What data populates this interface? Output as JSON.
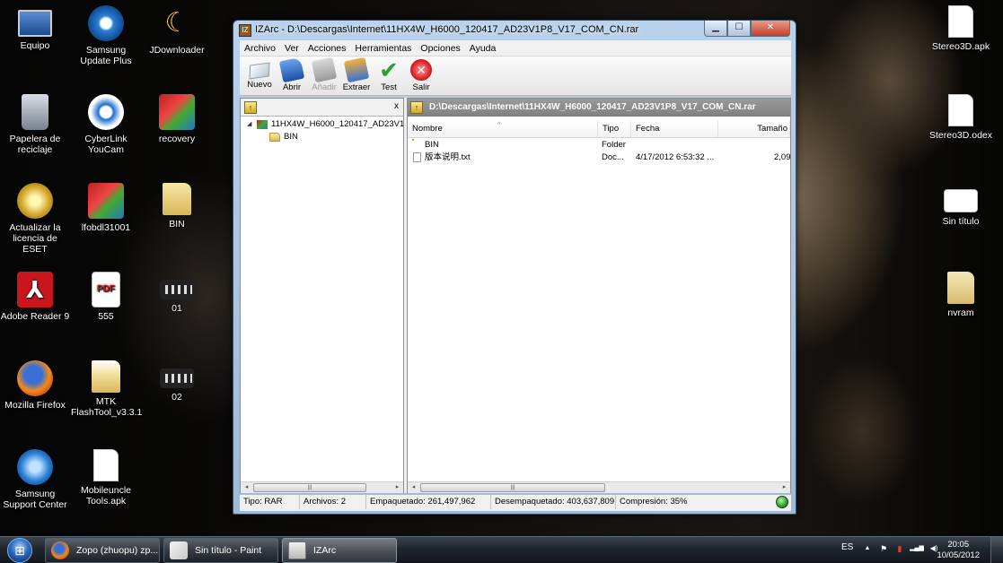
{
  "desktop": {
    "left_icons": [
      {
        "label": "Equipo",
        "icon": "computer-icon"
      },
      {
        "label": "Samsung Update Plus",
        "icon": "samsung-update-icon"
      },
      {
        "label": "JDownloader",
        "icon": "jdownloader-icon"
      },
      {
        "label": "Papelera de reciclaje",
        "icon": "recycle-bin-icon"
      },
      {
        "label": "CyberLink YouCam",
        "icon": "cyberlink-youcam-icon"
      },
      {
        "label": "recovery",
        "icon": "winrar-archive-icon"
      },
      {
        "label": "Actualizar la licencia de ESET",
        "icon": "eset-icon"
      },
      {
        "label": "lfobdl31001",
        "icon": "winrar-archive-icon"
      },
      {
        "label": "BIN",
        "icon": "folder-icon"
      },
      {
        "label": "Adobe Reader 9",
        "icon": "adobe-reader-icon"
      },
      {
        "label": "555",
        "icon": "pdf-file-icon"
      },
      {
        "label": "01",
        "icon": "video-file-icon"
      },
      {
        "label": "Mozilla Firefox",
        "icon": "firefox-icon"
      },
      {
        "label": "MTK FlashTool_v3.3.1",
        "icon": "folder-icon"
      },
      {
        "label": "02",
        "icon": "video-file-icon"
      },
      {
        "label": "Samsung Support Center",
        "icon": "samsung-support-icon"
      },
      {
        "label": "Mobileuncle Tools.apk",
        "icon": "file-icon"
      }
    ],
    "right_icons": [
      {
        "label": "Stereo3D.apk",
        "icon": "file-icon"
      },
      {
        "label": "Stereo3D.odex",
        "icon": "file-icon"
      },
      {
        "label": "Sin título",
        "icon": "image-file-icon"
      },
      {
        "label": "nvram",
        "icon": "folder-icon"
      }
    ]
  },
  "window": {
    "title": "IZArc - D:\\Descargas\\Internet\\11HX4W_H6000_120417_AD23V1P8_V17_COM_CN.rar",
    "app_icon_text": "IZ",
    "buttons": {
      "minimize": "▁",
      "maximize": "☐",
      "close": "✕"
    },
    "menu": [
      "Archivo",
      "Ver",
      "Acciones",
      "Herramientas",
      "Opciones",
      "Ayuda"
    ],
    "toolbar": {
      "nuevo": "Nuevo",
      "abrir": "Abrir",
      "anadir": "Añadir",
      "extraer": "Extraer",
      "test": "Test",
      "salir": "Salir"
    },
    "left_pane": {
      "close_label": "x",
      "tree": [
        {
          "label": "11HX4W_H6000_120417_AD23V1P8_V17_COM_CN.rar",
          "expander": "◢"
        },
        {
          "label": "BIN"
        }
      ]
    },
    "right_pane": {
      "path": "D:\\Descargas\\Internet\\11HX4W_H6000_120417_AD23V1P8_V17_COM_CN.rar",
      "columns": [
        "Nombre",
        "Tipo",
        "Fecha",
        "Tamaño"
      ],
      "rows": [
        {
          "name": "BIN",
          "type": "Folder",
          "date": "",
          "size": ""
        },
        {
          "name": "版本说明.txt",
          "type": "Doc...",
          "date": "4/17/2012 6:53:32 ...",
          "size": "2,09"
        }
      ]
    },
    "scroll": {
      "left_arrow": "◂",
      "right_arrow": "▸",
      "grip": "|||"
    },
    "status": {
      "tipo": "Tipo: RAR",
      "archivos": "Archivos: 2",
      "empaquetado": "Empaquetado: 261,497,962",
      "desempaquetado": "Desempaquetado: 403,637,809",
      "compresion": "Compresión: 35%"
    }
  },
  "taskbar": {
    "start_glyph": "⊞",
    "tasks": [
      {
        "label": "Zopo (zhuopu) zp...",
        "icon": "firefox-icon"
      },
      {
        "label": "Sin título - Paint",
        "icon": "paint-icon"
      },
      {
        "label": "IZArc",
        "icon": "izarc-icon"
      }
    ],
    "language": "ES",
    "tray_glyphs": {
      "chevron": "▲",
      "flag": "⚑",
      "network": "▮",
      "signal": "▂▄▆",
      "volume": "◀)"
    },
    "time": "20:05",
    "date": "10/05/2012"
  }
}
